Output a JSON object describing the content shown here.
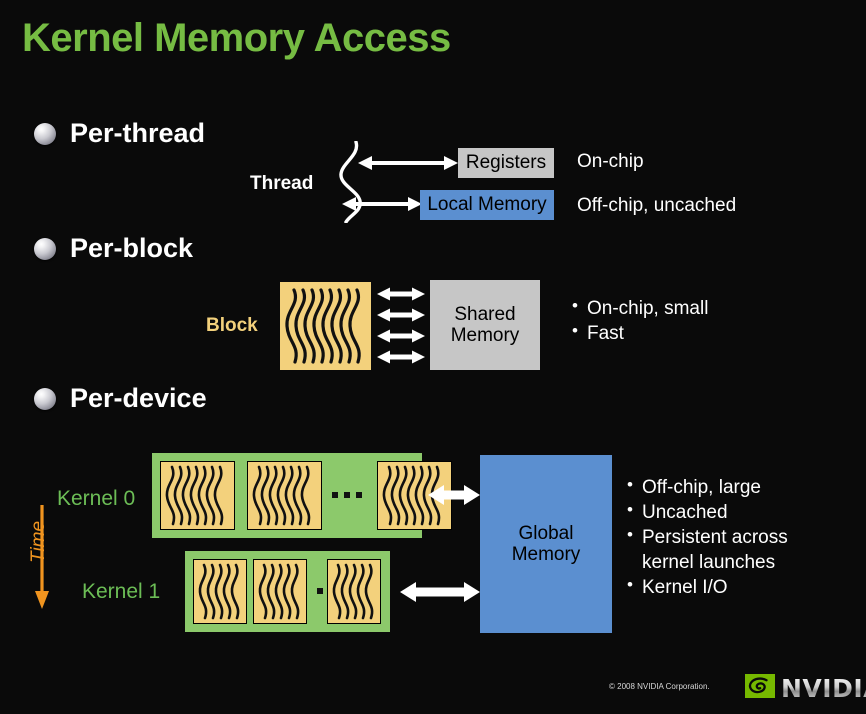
{
  "slide": {
    "title": "Kernel Memory Access",
    "background_color": "#0a0a0a",
    "title_color": "#76bc43"
  },
  "sections": [
    {
      "id": "per-thread",
      "label": "Per-thread"
    },
    {
      "id": "per-block",
      "label": "Per-block"
    },
    {
      "id": "per-device",
      "label": "Per-device"
    }
  ],
  "per_thread": {
    "actor_label": "Thread",
    "boxes": [
      {
        "label": "Registers",
        "color": "#c6c6c6"
      },
      {
        "label": "Local Memory",
        "color": "#5b8fd0"
      }
    ],
    "notes": [
      "On-chip",
      "Off-chip, uncached"
    ]
  },
  "per_block": {
    "actor_label": "Block",
    "memory_label_line1": "Shared",
    "memory_label_line2": "Memory",
    "memory_color": "#c6c6c6",
    "block_color": "#f3d17c",
    "arrow_count": 4,
    "bullets": [
      "On-chip, small",
      "Fast"
    ]
  },
  "per_device": {
    "time_label": "Time",
    "time_color": "#f0941f",
    "kernels": [
      {
        "label": "Kernel 0",
        "blocks_shown": 3,
        "ellipsis": "..."
      },
      {
        "label": "Kernel 1",
        "blocks_shown": 3,
        "ellipsis": "..."
      }
    ],
    "grid_color": "#8cc96b",
    "kernel_label_color": "#6cbd56",
    "memory_label_line1": "Global",
    "memory_label_line2": "Memory",
    "memory_color": "#5b8fd0",
    "bullets": [
      {
        "text": "Off-chip, large",
        "continuation": false
      },
      {
        "text": "Uncached",
        "continuation": false
      },
      {
        "text": "Persistent across",
        "continuation": false
      },
      {
        "text": "kernel launches",
        "continuation": true
      },
      {
        "text": "Kernel I/O",
        "continuation": false
      }
    ]
  },
  "footer": {
    "copyright": "© 2008 NVIDIA Corporation.",
    "logo_wordmark": "NVIDIA.",
    "logo_color": "#76b900"
  }
}
